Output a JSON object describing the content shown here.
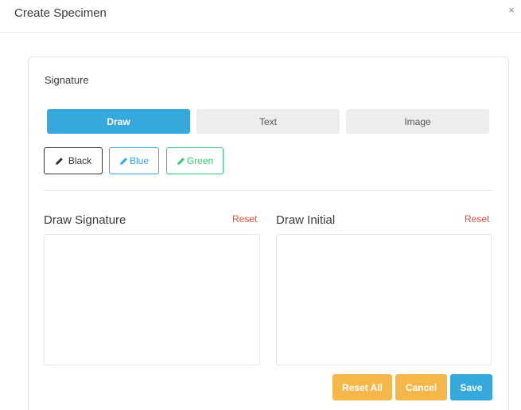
{
  "modal": {
    "title": "Create Specimen",
    "close_label": "×"
  },
  "signature": {
    "heading": "Signature",
    "tabs": [
      {
        "label": "Draw",
        "active": true
      },
      {
        "label": "Text",
        "active": false
      },
      {
        "label": "Image",
        "active": false
      }
    ],
    "colors": [
      {
        "label": "Black",
        "color": "#333333",
        "icon": "pen-icon"
      },
      {
        "label": "Blue",
        "color": "#35a8dc",
        "icon": "pen-icon"
      },
      {
        "label": "Green",
        "color": "#2ecc71",
        "icon": "pen-icon"
      }
    ],
    "draw_signature": {
      "title": "Draw Signature",
      "reset_label": "Reset"
    },
    "draw_initial": {
      "title": "Draw Initial",
      "reset_label": "Reset"
    }
  },
  "actions": {
    "reset_all_label": "Reset All",
    "cancel_label": "Cancel",
    "save_label": "Save"
  },
  "theme": {
    "primary": "#35a8dc",
    "warning": "#f6b74a",
    "danger": "#e74c3c",
    "success": "#2ecc71"
  }
}
